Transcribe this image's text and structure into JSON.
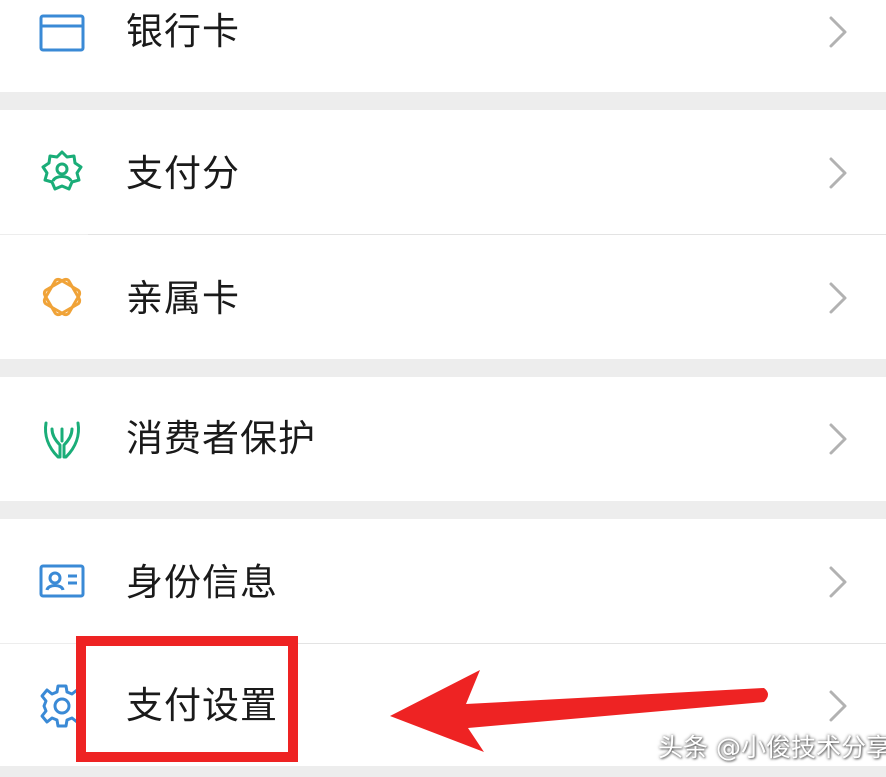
{
  "menu": {
    "items": [
      {
        "label": "银行卡",
        "icon": "bank-card-icon",
        "chevron": "chevron-right-icon"
      },
      {
        "label": "支付分",
        "icon": "pay-score-icon",
        "chevron": "chevron-right-icon"
      },
      {
        "label": "亲属卡",
        "icon": "family-card-icon",
        "chevron": "chevron-right-icon"
      },
      {
        "label": "消费者保护",
        "icon": "consumer-protection-icon",
        "chevron": "chevron-right-icon"
      },
      {
        "label": "身份信息",
        "icon": "id-card-icon",
        "chevron": "chevron-right-icon"
      },
      {
        "label": "支付设置",
        "icon": "gear-icon",
        "chevron": "chevron-right-icon"
      }
    ]
  },
  "annotation": {
    "highlight_color": "#ee2323",
    "arrow_color": "#ee2323"
  },
  "watermark": {
    "text": "头条 @小俊技术分享"
  },
  "colors": {
    "icon_blue": "#3a8ad6",
    "icon_green": "#1aad78",
    "icon_orange": "#f0a338",
    "chevron": "#b2b2b2",
    "background": "#ededed"
  }
}
